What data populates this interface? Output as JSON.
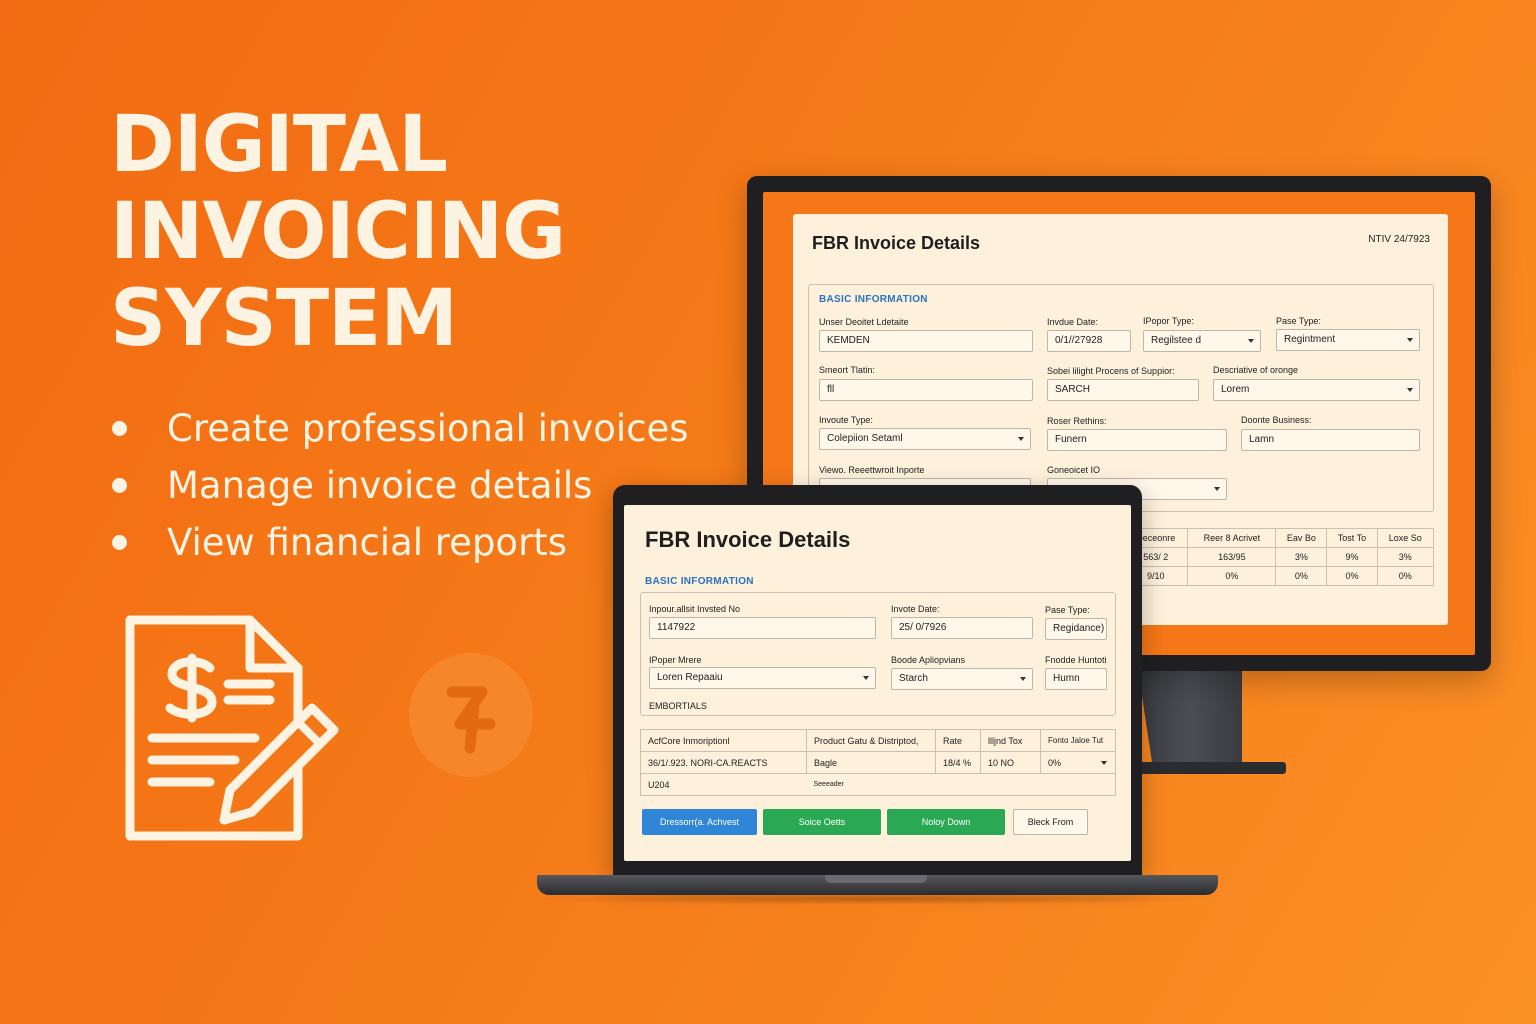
{
  "hero": {
    "title_lines": [
      "DIGITAL",
      "INVOICING",
      "SYSTEM"
    ],
    "bullets": [
      "Create professional invoices",
      "Manage invoice details",
      "View financial reports"
    ]
  },
  "colors": {
    "background": "#f57718",
    "cream": "#fdf3e3",
    "panel": "#fdf1dc",
    "accent_blue": "#2b72c4",
    "button_blue": "#2f86d6",
    "button_green": "#2aa853"
  },
  "icons": [
    "invoice-dollar-pencil-icon",
    "coin-icon"
  ],
  "monitor": {
    "title": "FBR Invoice Details",
    "meta": "NTIV  24/7923",
    "section": "BASIC INFORMATION",
    "fields": {
      "f1": {
        "label": "Unser Deoitet Ldetaite",
        "value": "KEMDEN"
      },
      "f2": {
        "label": "Invdue Date:",
        "value": "0/1//27928"
      },
      "f3": {
        "label": "IPopor Type:",
        "value": "Regilstee d"
      },
      "f4": {
        "label": "Pase Type:",
        "value": "Regintment"
      },
      "f5": {
        "label": "Smeort Tlatin:",
        "value": "fll"
      },
      "f6": {
        "label": "Sobei lilight Procens of Suppior:",
        "value": "SARCH"
      },
      "f7": {
        "label": "Descriative of oronge",
        "value": "Lorem"
      },
      "f8": {
        "label": "Invoute Type:",
        "value": "Colepiion Setaml"
      },
      "f9": {
        "label": "Roser Rethins:",
        "value": "Funern"
      },
      "f10": {
        "label": "Doonte Business:",
        "value": "Lamn"
      },
      "f11": {
        "label": "Viewo. Reeettwroit Inporte",
        "value": ""
      },
      "f12": {
        "label": "Goneoicet IO",
        "value": ""
      }
    },
    "table": {
      "headers": [
        "Deceonre",
        "Reer 8 Acrivet",
        "Eav Bo",
        "Tost To",
        "Loxe So"
      ],
      "rows": [
        [
          "563/ 2",
          "163/95",
          "3%",
          "9%",
          "3%"
        ],
        [
          "9/10",
          "0%",
          "0%",
          "0%",
          "0%"
        ]
      ]
    }
  },
  "laptop": {
    "title": "FBR Invoice Details",
    "section": "BASIC INFORMATION",
    "fields": {
      "f1": {
        "label": "Inpour.allsit Invsted No",
        "value": "1147922"
      },
      "f2": {
        "label": "Invote Date:",
        "value": "25/ 0/7926"
      },
      "f3": {
        "label": "Pase Type:",
        "value": "Regidance)"
      },
      "f4": {
        "label": "IPoper Mrere",
        "value": "Loren Repaaiu"
      },
      "f5": {
        "label": "Boode Apliopvians",
        "value": "Starch"
      },
      "f6": {
        "label": "Fnodde Huntoti",
        "value": "Humn"
      }
    },
    "subsection": "EMBORTIALS",
    "table": {
      "headers": [
        "AcfCore Inmoriptionl",
        "Product Gatu & Distriptod,",
        "Rate",
        "llljnd Tox",
        "Fonto Jaloe Tut"
      ],
      "row": [
        "36/1/.923.  NORI-CA.REACTS",
        "Bagle",
        "18/4 %",
        "10 NO",
        "0%"
      ],
      "footer": [
        "U204",
        "Seeeader"
      ]
    },
    "buttons": [
      "Dressorr(a. Achvest",
      "Soice Oetts",
      "Noloy Down",
      "Bleck From"
    ]
  }
}
